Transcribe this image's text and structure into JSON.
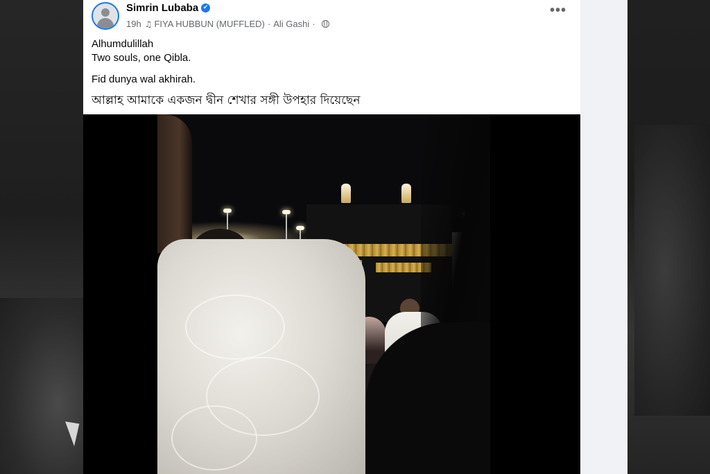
{
  "post": {
    "author": "Simrin Lubaba",
    "verified": true,
    "time": "19h",
    "music": "FIYA HUBBUN (MUFFLED)",
    "artist": "Ali Gashi",
    "privacy_icon": "globe-icon",
    "more_label": "•••",
    "text_lines": [
      "Alhumdulillah",
      "Two souls, one Qibla.",
      "Fid dunya wal akhirah.",
      "আল্লাহ আমাকে একজন দ্বীন শেখার সঙ্গী উপহার দিয়েছেন"
    ]
  },
  "colors": {
    "accent": "#1877f2",
    "secondary_text": "#65676b",
    "primary_text": "#050505"
  }
}
